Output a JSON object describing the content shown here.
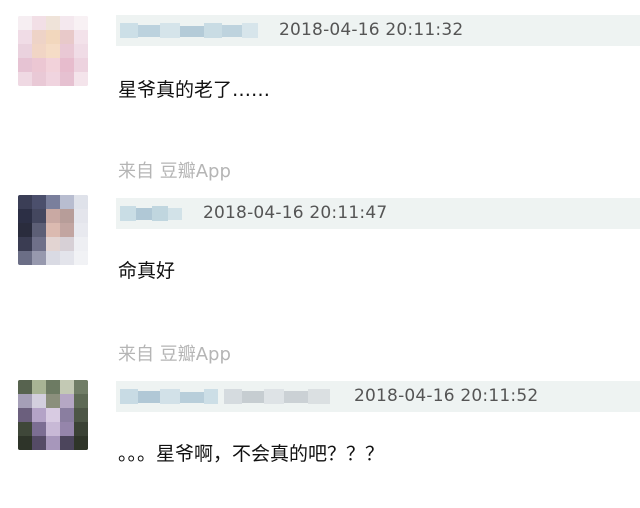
{
  "comments": [
    {
      "timestamp": "2018-04-16 20:11:32",
      "text": "星爷真的老了……",
      "source": "来自 豆瓣App"
    },
    {
      "timestamp": "2018-04-16 20:11:47",
      "text": "命真好",
      "source": "来自 豆瓣App"
    },
    {
      "timestamp": "2018-04-16 20:11:52",
      "text": "。。。星爷啊，不会真的吧？？？"
    }
  ],
  "colors": {
    "meta_bar": "#eef3f2",
    "timestamp": "#555555",
    "source": "#b5b5b5",
    "text": "#111111"
  },
  "icons": [
    "avatar-blurred",
    "username-blurred"
  ]
}
